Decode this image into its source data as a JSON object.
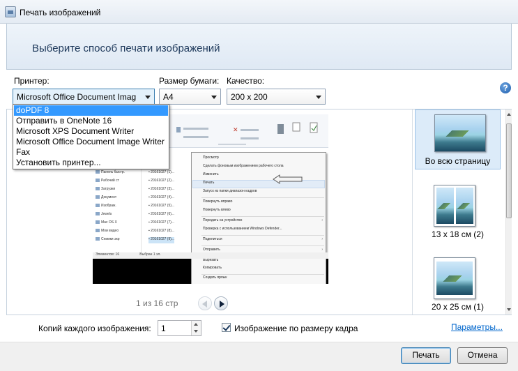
{
  "window": {
    "title": "Печать изображений"
  },
  "header": {
    "title": "Выберите способ печати изображений"
  },
  "controls": {
    "printer_label": "Принтер:",
    "printer_value": "Microsoft Office Document Imag",
    "paper_label": "Размер бумаги:",
    "paper_value": "A4",
    "quality_label": "Качество:",
    "quality_value": "200 x 200",
    "help": "?"
  },
  "printer_dropdown": {
    "options": [
      "doPDF 8",
      "Отправить в OneNote 16",
      "Microsoft XPS Document Writer",
      "Microsoft Office Document Image Writer",
      "Fax",
      "Установить принтер..."
    ],
    "selected_index": 0
  },
  "preview": {
    "page_indicator": "1 из 16 стр",
    "context_menu_items": [
      "Просмотр",
      "Сделать фоновым изображением рабочего стола",
      "Изменить",
      "Печать",
      "Запуск из папки диапазон кадров",
      "Повернуть вправо",
      "Повернуть влево",
      "Передать на устройство",
      "Проверка с использованием Windows Defender...",
      "Поделиться",
      "Отправить",
      "Вырезать",
      "Копировать",
      "Создать ярлык",
      "Удалить"
    ]
  },
  "layouts": [
    {
      "label": "Во всю страницу",
      "selected": true
    },
    {
      "label": "13 x 18 см (2)",
      "selected": false
    },
    {
      "label": "20 x 25 см (1)",
      "selected": false
    }
  ],
  "footer": {
    "copies_label": "Копий каждого изображения:",
    "copies_value": "1",
    "fit_label": "Изображение по размеру кадра",
    "fit_checked": true,
    "options_link": "Параметры..."
  },
  "buttons": {
    "print": "Печать",
    "cancel": "Отмена"
  }
}
